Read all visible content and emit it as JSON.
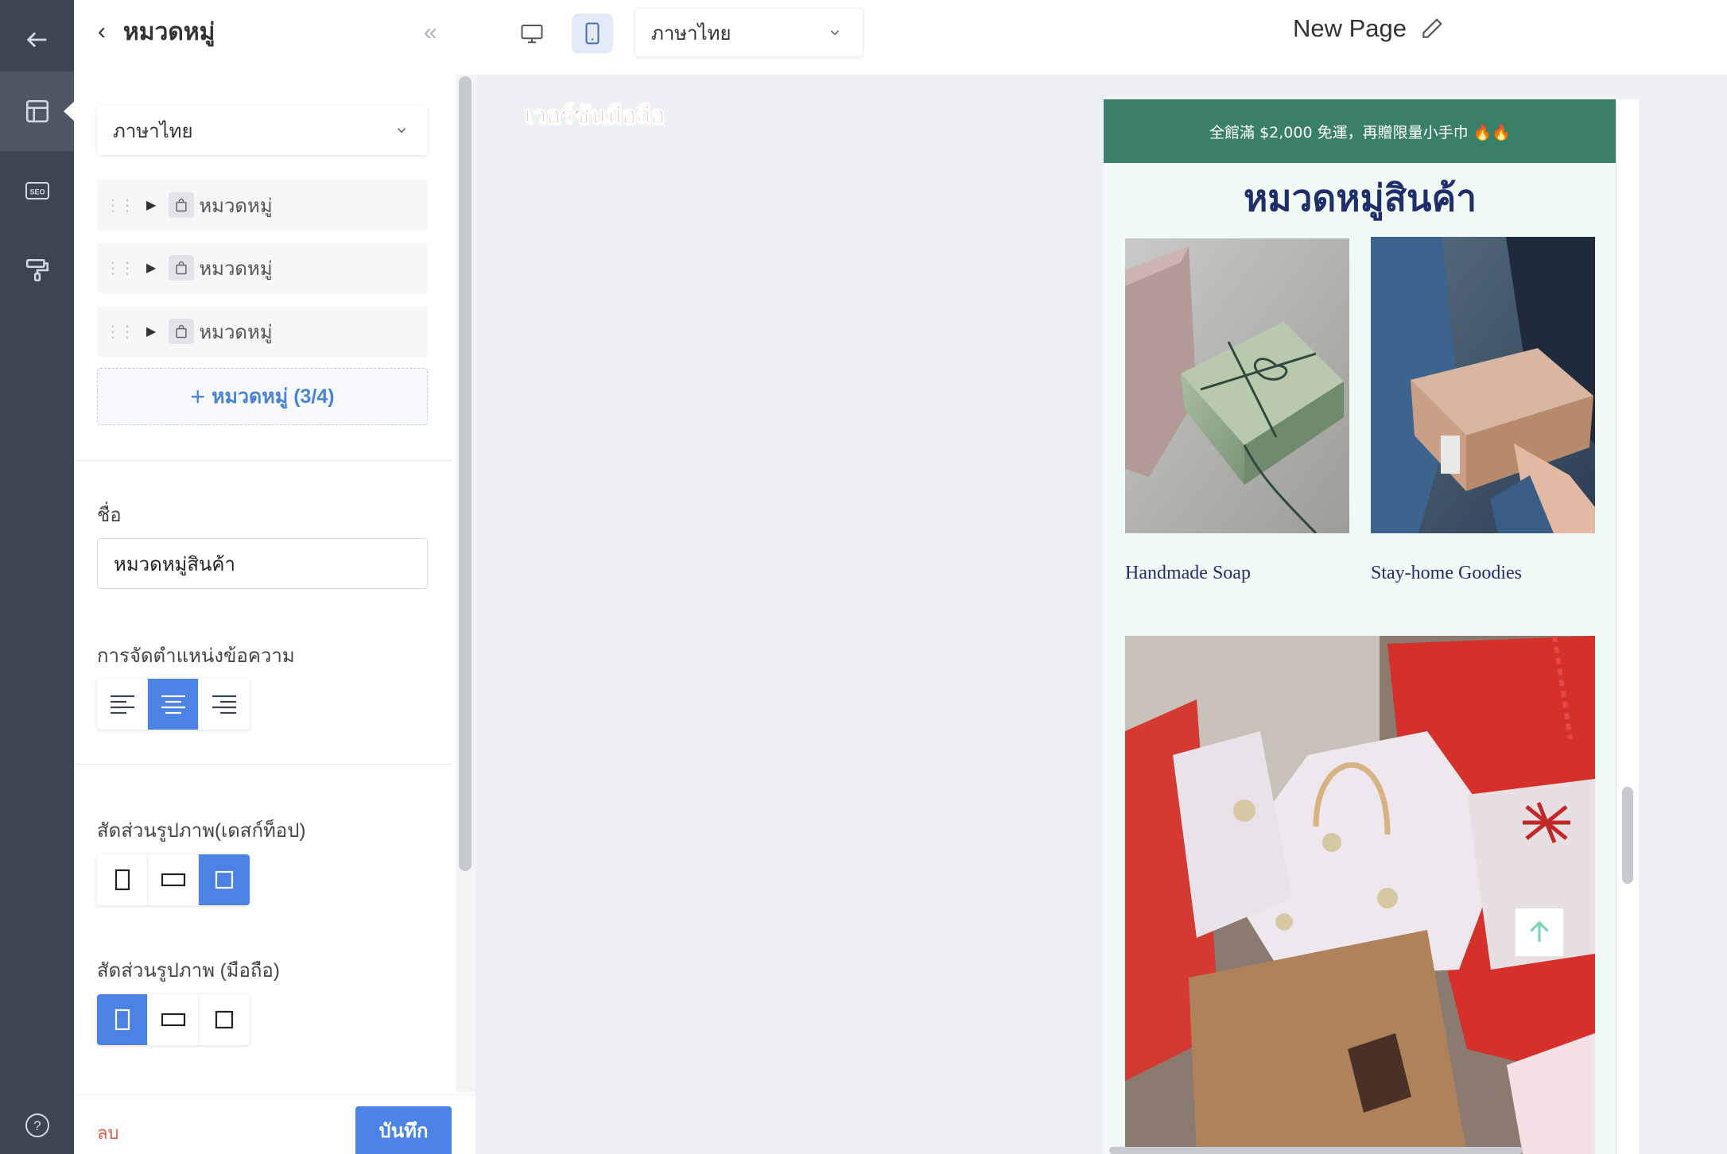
{
  "topbar": {
    "panel_title": "หมวดหมู่",
    "language": "ภาษาไทย",
    "page_title": "New Page"
  },
  "rail": {
    "items": [
      "back-arrow-icon",
      "layout-icon",
      "seo-icon",
      "paint-roller-icon",
      "help-icon"
    ],
    "seo_text": "SEO",
    "help_text": "?"
  },
  "panel": {
    "language": "ภาษาไทย",
    "categories": [
      {
        "label": "หมวดหมู่"
      },
      {
        "label": "หมวดหมู่"
      },
      {
        "label": "หมวดหมู่"
      }
    ],
    "add_category_label": "หมวดหมู่ (3/4)",
    "name_label": "ชื่อ",
    "name_value": "หมวดหมู่สินค้า",
    "alignment_label": "การจัดตำแหน่งข้อความ",
    "alignment_selected": "center",
    "aspect_desktop_label": "สัดส่วนรูปภาพ(เดสก์ท็อป)",
    "aspect_desktop_selected": "square",
    "aspect_mobile_label": "สัดส่วนรูปภาพ (มือถือ)",
    "aspect_mobile_selected": "portrait",
    "delete_label": "ลบ",
    "save_label": "บันทึก"
  },
  "canvas": {
    "mobile_version_tag": "เวอร์ชันมือถือ",
    "announcement": "全館滿 $2,000 免運，再贈限量小手巾 🔥🔥",
    "section_title": "หมวดหมู่สินค้า",
    "cards": [
      {
        "caption": "Handmade Soap"
      },
      {
        "caption": "Stay-home Goodies"
      }
    ]
  },
  "colors": {
    "rail": "#3d4452",
    "accent": "#4a83e4",
    "announcement_bg": "#3a8067",
    "title_navy": "#1f2f6b",
    "danger": "#e05b4b"
  }
}
